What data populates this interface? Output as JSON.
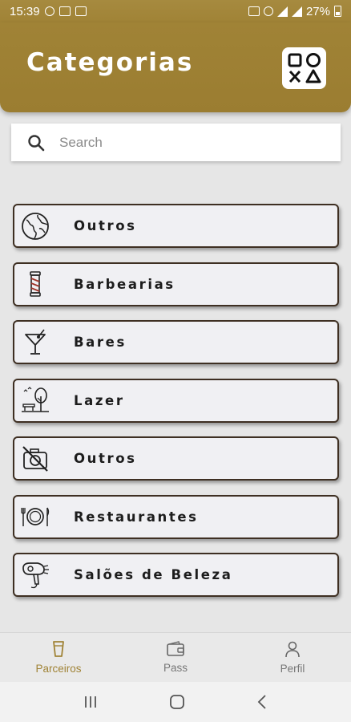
{
  "status_bar": {
    "time": "15:39",
    "battery": "27%"
  },
  "header": {
    "title": "Categorias"
  },
  "search": {
    "placeholder": "Search"
  },
  "categories": [
    {
      "label": "Outros",
      "icon": "globe-icon"
    },
    {
      "label": "Barbearias",
      "icon": "barber-pole-icon"
    },
    {
      "label": "Bares",
      "icon": "cocktail-icon"
    },
    {
      "label": "Lazer",
      "icon": "park-icon"
    },
    {
      "label": "Outros",
      "icon": "no-camera-icon"
    },
    {
      "label": "Restaurantes",
      "icon": "plate-cutlery-icon"
    },
    {
      "label": "Salões de Beleza",
      "icon": "hair-dryer-icon"
    }
  ],
  "bottom_nav": {
    "items": [
      {
        "label": "Parceiros",
        "icon": "beer-glass-icon",
        "active": true
      },
      {
        "label": "Pass",
        "icon": "wallet-icon",
        "active": false
      },
      {
        "label": "Perfil",
        "icon": "user-icon",
        "active": false
      }
    ]
  },
  "colors": {
    "brand": "#a08336",
    "card_border": "#3e2f22",
    "card_bg": "#f0f0f3"
  }
}
